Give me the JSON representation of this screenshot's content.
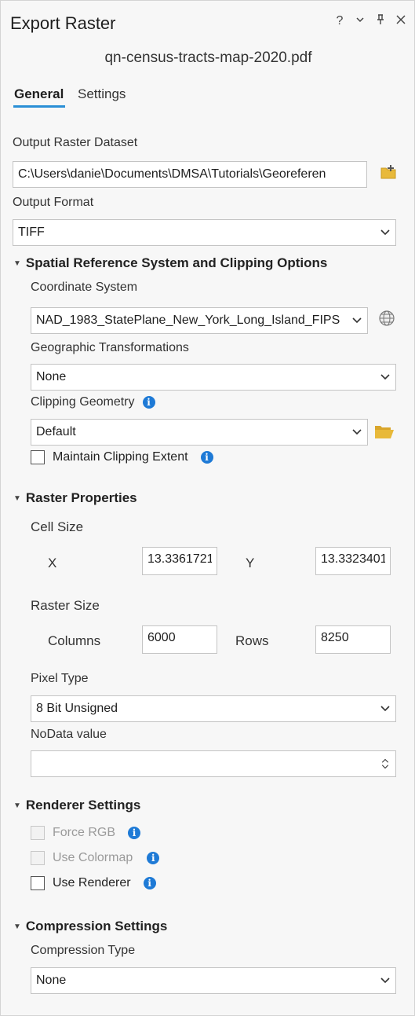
{
  "window": {
    "title": "Export Raster",
    "controls": [
      "?",
      "⌄",
      "⊥",
      "✕"
    ]
  },
  "file_name": "qn-census-tracts-map-2020.pdf",
  "tabs": [
    {
      "label": "General",
      "active": true
    },
    {
      "label": "Settings",
      "active": false
    }
  ],
  "output_raster": {
    "label": "Output Raster Dataset",
    "value": "C:\\Users\\danie\\Documents\\DMSA\\Tutorials\\Georeferen"
  },
  "output_format": {
    "label": "Output Format",
    "value": "TIFF"
  },
  "spatial_section": {
    "title": "Spatial Reference System and Clipping Options",
    "coordinate_system": {
      "label": "Coordinate System",
      "value": "NAD_1983_StatePlane_New_York_Long_Island_FIPS"
    },
    "geo_transformations": {
      "label": "Geographic Transformations",
      "value": "None"
    },
    "clipping_geometry": {
      "label": "Clipping Geometry",
      "value": "Default"
    },
    "maintain_clipping": {
      "label": "Maintain Clipping Extent",
      "checked": false
    }
  },
  "raster_section": {
    "title": "Raster Properties",
    "cell_size": {
      "label": "Cell Size",
      "x_label": "X",
      "x_value": "13.3361721",
      "y_label": "Y",
      "y_value": "13.3323401"
    },
    "raster_size": {
      "label": "Raster Size",
      "columns_label": "Columns",
      "columns_value": "6000",
      "rows_label": "Rows",
      "rows_value": "8250"
    },
    "pixel_type": {
      "label": "Pixel Type",
      "value": "8 Bit Unsigned"
    },
    "nodata": {
      "label": "NoData value",
      "value": ""
    }
  },
  "renderer_section": {
    "title": "Renderer Settings",
    "force_rgb": {
      "label": "Force RGB",
      "enabled": false
    },
    "use_colormap": {
      "label": "Use Colormap",
      "enabled": false
    },
    "use_renderer": {
      "label": "Use Renderer",
      "enabled": true
    }
  },
  "compression_section": {
    "title": "Compression Settings",
    "compression_type": {
      "label": "Compression Type",
      "value": "None"
    }
  },
  "colors": {
    "accent": "#2a8fd6",
    "info_icon": "#1e7ad6",
    "folder_icon": "#e8b93a"
  }
}
